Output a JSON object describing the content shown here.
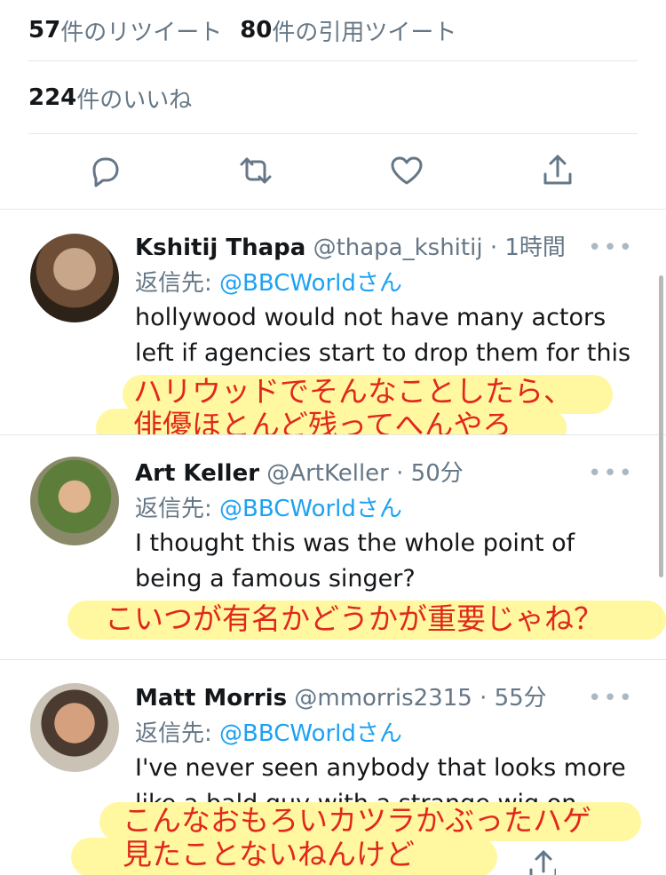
{
  "stats": {
    "retweets_count": "57",
    "retweets_label": "件のリツイート",
    "quotes_count": "80",
    "quotes_label": "件の引用ツイート",
    "likes_count": "224",
    "likes_label": "件のいいね"
  },
  "action_icons": [
    "reply-icon",
    "retweet-icon",
    "like-icon",
    "share-icon"
  ],
  "tweets": [
    {
      "name": "Kshitij Thapa",
      "handle": "@thapa_kshitij",
      "time": "· 1時間",
      "reply_prefix": "返信先: ",
      "reply_mention": "@BBCWorldさん",
      "text": "hollywood would not have many actors left if agencies start to drop them for this",
      "overlay_line1": "ハリウッドでそんなことしたら、",
      "overlay_line2": "俳優ほとんど残ってへんやろ"
    },
    {
      "name": "Art Keller",
      "handle": "@ArtKeller",
      "time": "· 50分",
      "reply_prefix": "返信先: ",
      "reply_mention": "@BBCWorldさん",
      "text": "I thought this was the whole point of being a famous singer?",
      "overlay_line1": "こいつが有名かどうかが重要じゃね？"
    },
    {
      "name": "Matt Morris",
      "handle": "@mmorris2315",
      "time": "· 55分",
      "reply_prefix": "返信先: ",
      "reply_mention": "@BBCWorldさん",
      "text": "I've never seen anybody that looks more like a bald guy with a strange wig on",
      "overlay_line1": "こんなおもろいカツラかぶったハゲ",
      "overlay_line2": "見たことないねんけど"
    }
  ],
  "more_label": "•••",
  "colors": {
    "link": "#1da1f2",
    "muted": "#657786",
    "highlight": "#fff8a0",
    "overlay_text": "#e0281c"
  }
}
